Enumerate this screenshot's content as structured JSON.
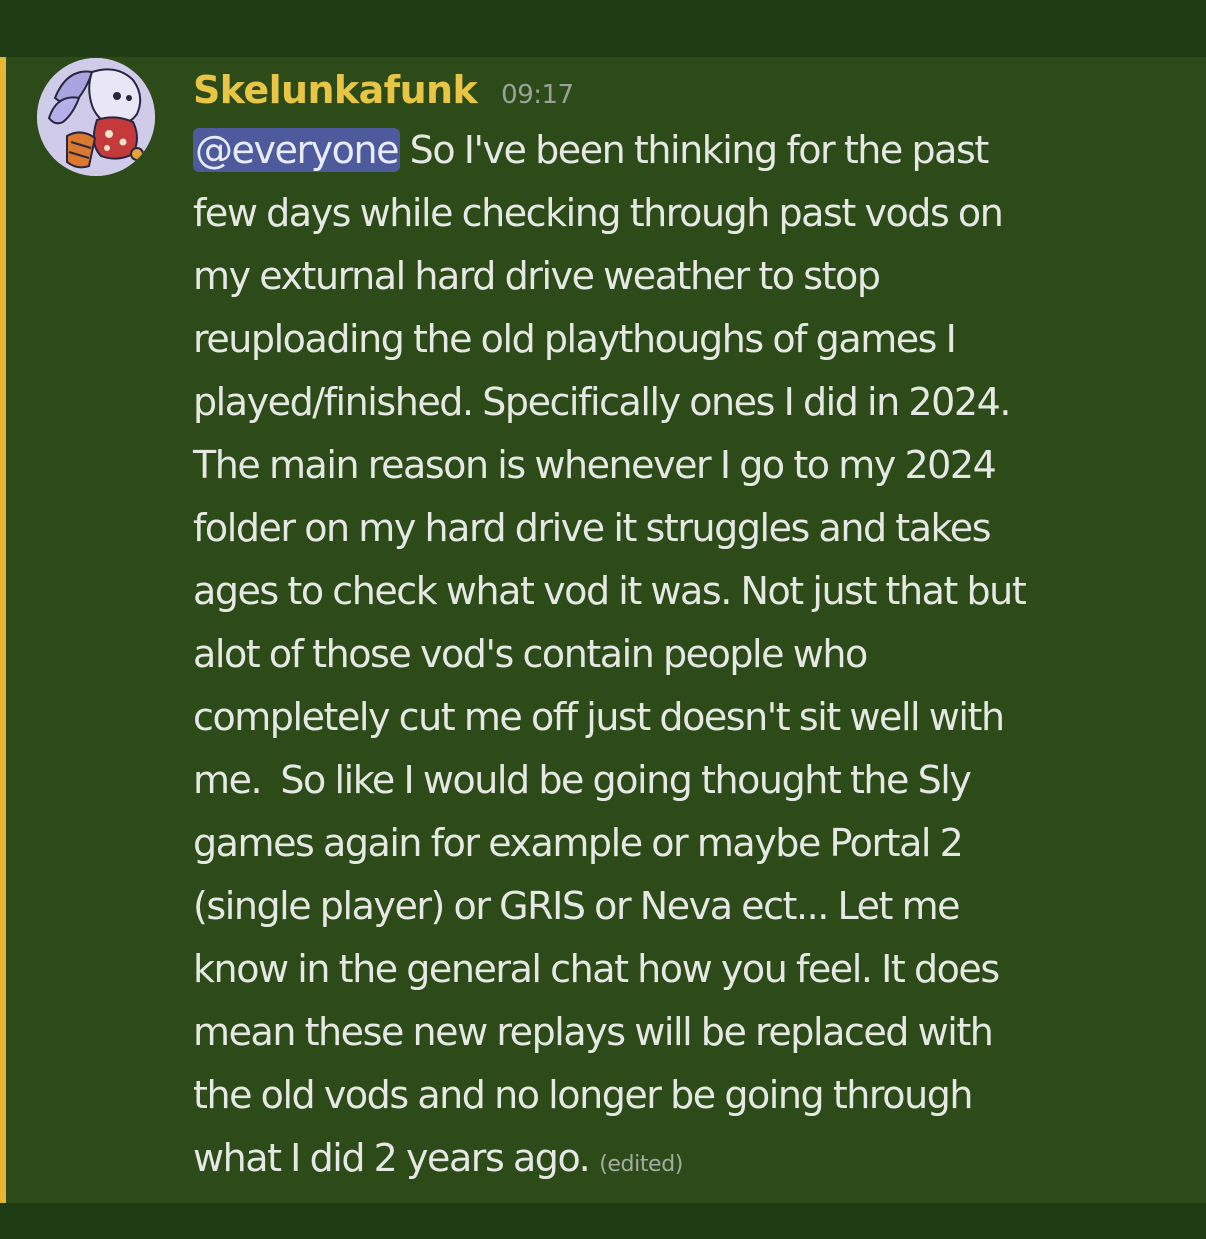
{
  "message": {
    "author": "Skelunkafunk",
    "timestamp": "09:17",
    "mention": "@everyone",
    "body": " So I've been thinking for the past\nfew days while checking through past vods on\nmy exturnal hard drive weather to stop\nreuploading the old playthoughs of games I\nplayed/finished. Specifically ones I did in 2024.\nThe main reason is whenever I go to my 2024\nfolder on my hard drive it struggles and takes\nages to check what vod it was. Not just that but\nalot of those vod's contain people who\ncompletely cut me off just doesn't sit well with\nme.  So like I would be going thought the Sly\ngames again for example or maybe Portal 2\n(single player) or GRIS or Neva ect... Let me\nknow in the general chat how you feel. It does\nmean these new replays will be replaced with\nthe old vods and no longer be going through\nwhat I did 2 years ago.",
    "edited_label": "(edited)"
  },
  "colors": {
    "background": "#1f3d14",
    "message_highlight": "#2d4a19",
    "mention_bar": "#e7b634",
    "username": "#e8c545",
    "mention_pill": "#4d5a9c"
  }
}
